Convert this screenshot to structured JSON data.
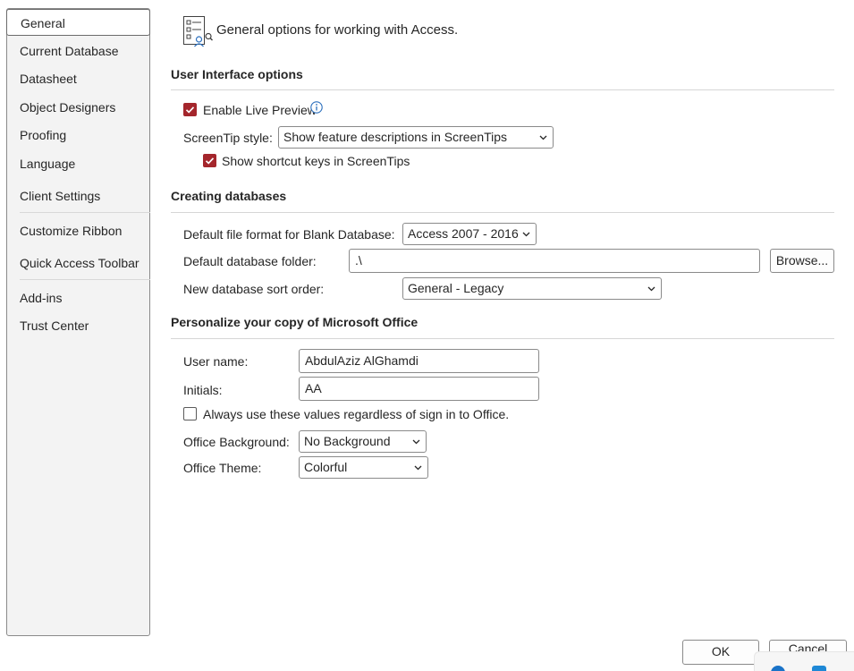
{
  "sidebar": {
    "items": [
      {
        "label": "General",
        "selected": true
      },
      {
        "label": "Current Database"
      },
      {
        "label": "Datasheet"
      },
      {
        "label": "Object Designers"
      },
      {
        "label": "Proofing"
      },
      {
        "label": "Language"
      },
      {
        "label": "Client Settings"
      },
      {
        "label": "Customize Ribbon"
      },
      {
        "label": "Quick Access Toolbar"
      },
      {
        "label": "Add-ins"
      },
      {
        "label": "Trust Center"
      }
    ]
  },
  "header": {
    "icon": "general-options-icon",
    "text": "General options for working with Access."
  },
  "ui_options": {
    "title": "User Interface options",
    "live_preview_label": "Enable Live Preview",
    "live_preview_checked": true,
    "screentip_label": "ScreenTip style:",
    "screentip_value": "Show feature descriptions in ScreenTips",
    "shortcut_keys_label": "Show shortcut keys in ScreenTips",
    "shortcut_keys_checked": true
  },
  "creating_databases": {
    "title": "Creating databases",
    "file_format_label": "Default file format for Blank Database:",
    "file_format_value": "Access 2007 - 2016",
    "folder_label": "Default database folder:",
    "folder_value": ".\\",
    "browse_label": "Browse...",
    "sort_order_label": "New database sort order:",
    "sort_order_value": "General - Legacy"
  },
  "personalize": {
    "title": "Personalize your copy of Microsoft Office",
    "user_name_label": "User name:",
    "user_name_value": "AbdulAziz AlGhamdi",
    "initials_label": "Initials:",
    "initials_value": "AA",
    "always_use_label": "Always use these values regardless of sign in to Office.",
    "always_use_checked": false,
    "background_label": "Office Background:",
    "background_value": "No Background",
    "theme_label": "Office Theme:",
    "theme_value": "Colorful"
  },
  "footer": {
    "ok_label": "OK",
    "cancel_label": "Cancel"
  },
  "colors": {
    "accent": "#a4262c",
    "info_icon": "#2b6fbd"
  }
}
